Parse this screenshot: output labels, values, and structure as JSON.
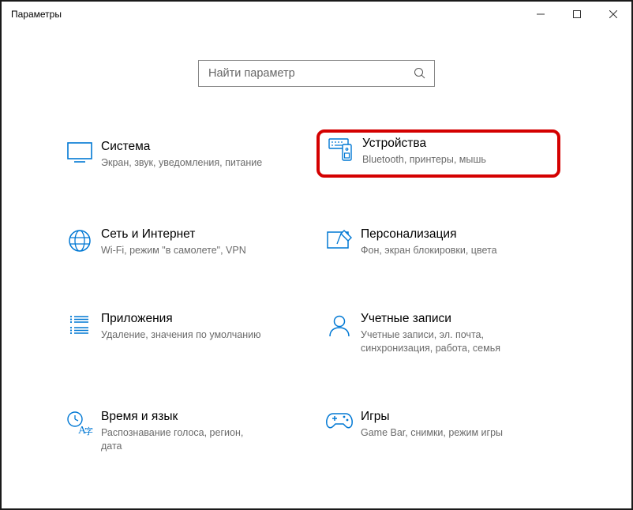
{
  "window": {
    "title": "Параметры"
  },
  "search": {
    "placeholder": "Найти параметр"
  },
  "tiles": {
    "system": {
      "title": "Система",
      "sub": "Экран, звук, уведомления, питание"
    },
    "devices": {
      "title": "Устройства",
      "sub": "Bluetooth, принтеры, мышь"
    },
    "network": {
      "title": "Сеть и Интернет",
      "sub": "Wi-Fi, режим \"в самолете\", VPN"
    },
    "personal": {
      "title": "Персонализация",
      "sub": "Фон, экран блокировки, цвета"
    },
    "apps": {
      "title": "Приложения",
      "sub": "Удаление, значения по умолчанию"
    },
    "accounts": {
      "title": "Учетные записи",
      "sub": "Учетные записи, эл. почта, синхронизация, работа, семья"
    },
    "time": {
      "title": "Время и язык",
      "sub": "Распознавание голоса, регион, дата"
    },
    "gaming": {
      "title": "Игры",
      "sub": "Game Bar, снимки, режим игры"
    }
  }
}
